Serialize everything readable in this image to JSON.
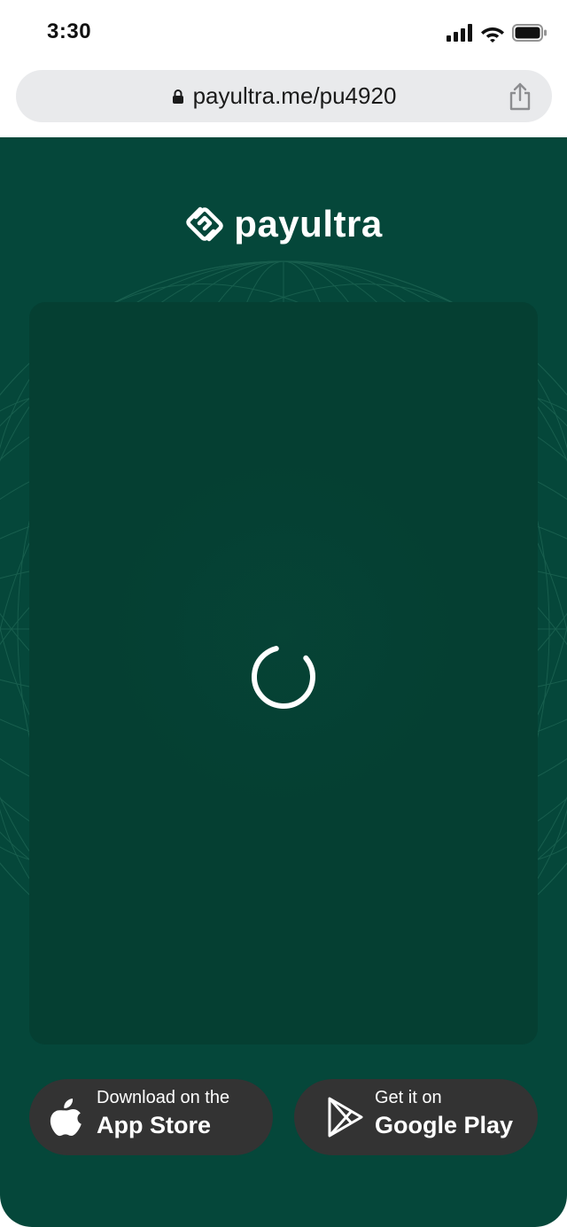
{
  "status_bar": {
    "time": "3:30",
    "icons": [
      "signal-icon",
      "wifi-icon",
      "battery-icon"
    ]
  },
  "browser": {
    "url": "payultra.me/pu4920",
    "icons": [
      "lock-icon",
      "share-icon"
    ]
  },
  "brand": {
    "name": "payultra",
    "logo_icon": "payultra-logo-icon"
  },
  "card": {
    "loading_icon": "loading-spinner-icon"
  },
  "store_buttons": {
    "app_store": {
      "sub_label": "Download on the",
      "main_label": "App Store",
      "icon": "apple-icon"
    },
    "google_play": {
      "sub_label": "Get it on",
      "main_label": "Google Play",
      "icon": "google-play-icon"
    }
  },
  "colors": {
    "background_green": "#05473a",
    "card_green": "#053f32",
    "button_dark": "#333333",
    "url_bar_bg": "#e9eaec",
    "text_light": "#ffffff"
  }
}
